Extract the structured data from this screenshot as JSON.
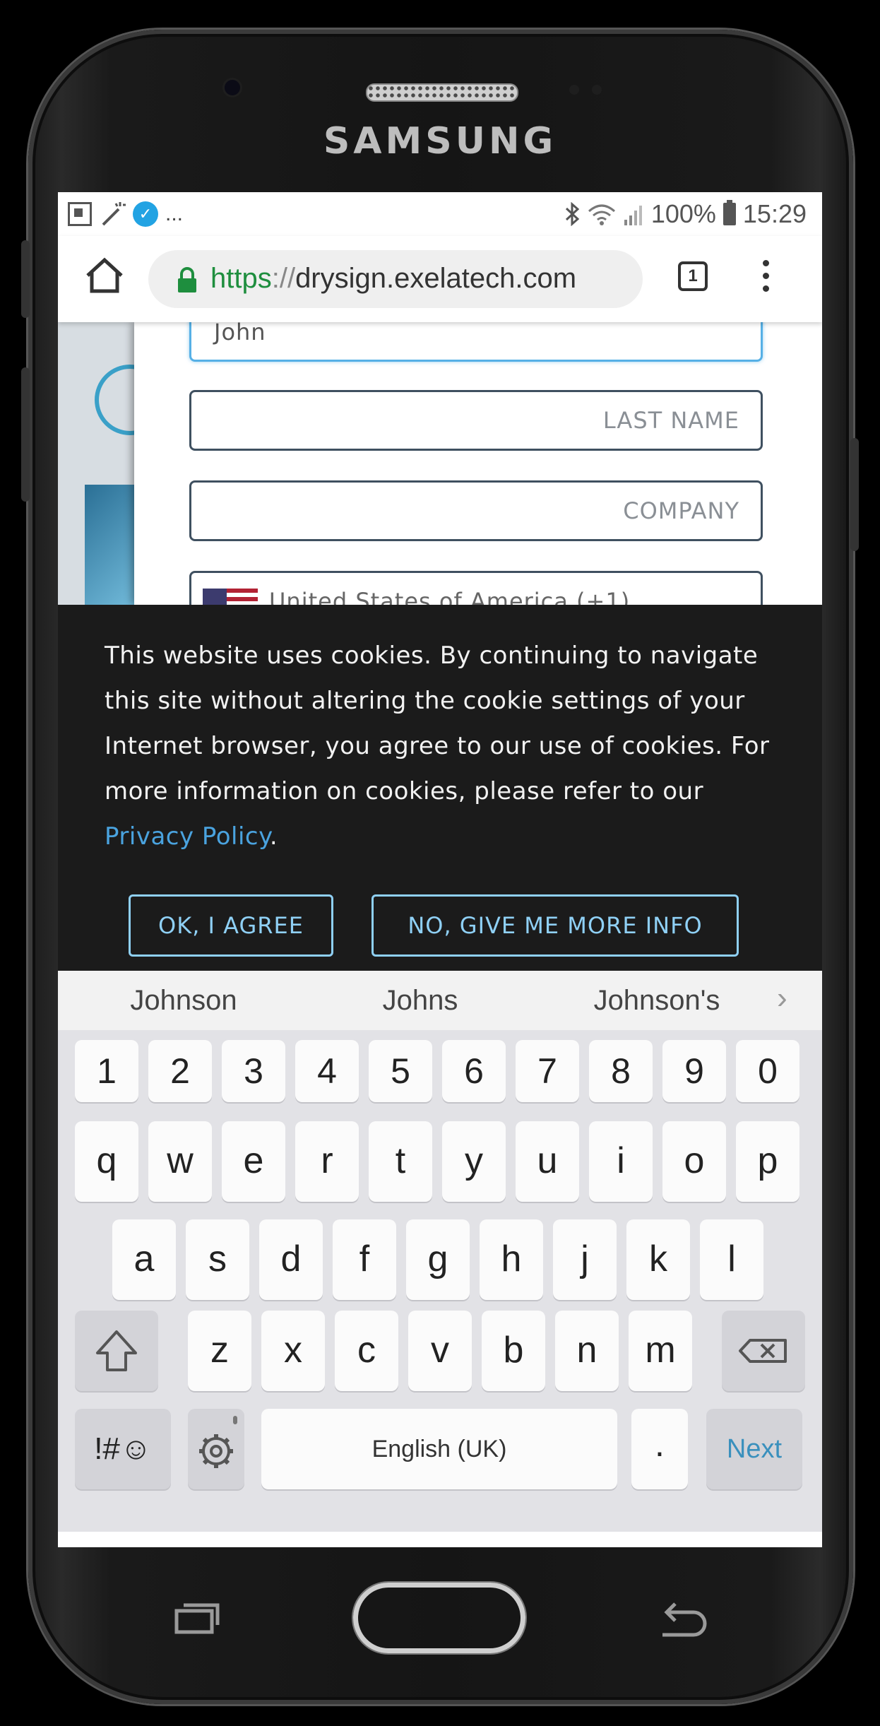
{
  "device": {
    "brand": "SAMSUNG"
  },
  "statusbar": {
    "overflow_indicator": "...",
    "battery": "100%",
    "time": "15:29",
    "icons": [
      "flipboard-icon",
      "magic-wand-icon",
      "messenger-icon",
      "bluetooth-icon",
      "wifi-icon",
      "signal-icon",
      "battery-icon"
    ]
  },
  "browser": {
    "url_scheme": "https",
    "url_separator": "://",
    "url_host": "drysign.exelatech.com",
    "tab_count": "1"
  },
  "form": {
    "first_name_value": "John",
    "last_name_placeholder": "LAST NAME",
    "company_placeholder": "COMPANY",
    "country_value": "United States of America (+1)"
  },
  "cookie_banner": {
    "text": "This website uses cookies. By continuing to navigate this site without altering the cookie settings of your Internet browser, you agree to our use of cookies. For more information on cookies, please refer to our ",
    "link_text": "Privacy Policy",
    "trailing": ".",
    "agree_label": "OK, I AGREE",
    "more_info_label": "NO, GIVE ME MORE INFO",
    "link_color": "#4aa3df",
    "button_color": "#8fd0f5"
  },
  "suggestions": [
    "Johnson",
    "Johns",
    "Johnson's"
  ],
  "keyboard": {
    "numbers": [
      "1",
      "2",
      "3",
      "4",
      "5",
      "6",
      "7",
      "8",
      "9",
      "0"
    ],
    "row1": [
      "q",
      "w",
      "e",
      "r",
      "t",
      "y",
      "u",
      "i",
      "o",
      "p"
    ],
    "row2": [
      "a",
      "s",
      "d",
      "f",
      "g",
      "h",
      "j",
      "k",
      "l"
    ],
    "row3": [
      "z",
      "x",
      "c",
      "v",
      "b",
      "n",
      "m"
    ],
    "symbols_label": "!#☺",
    "space_label": "English (UK)",
    "period_label": ".",
    "next_label": "Next",
    "accent_color": "#3a90bd"
  }
}
